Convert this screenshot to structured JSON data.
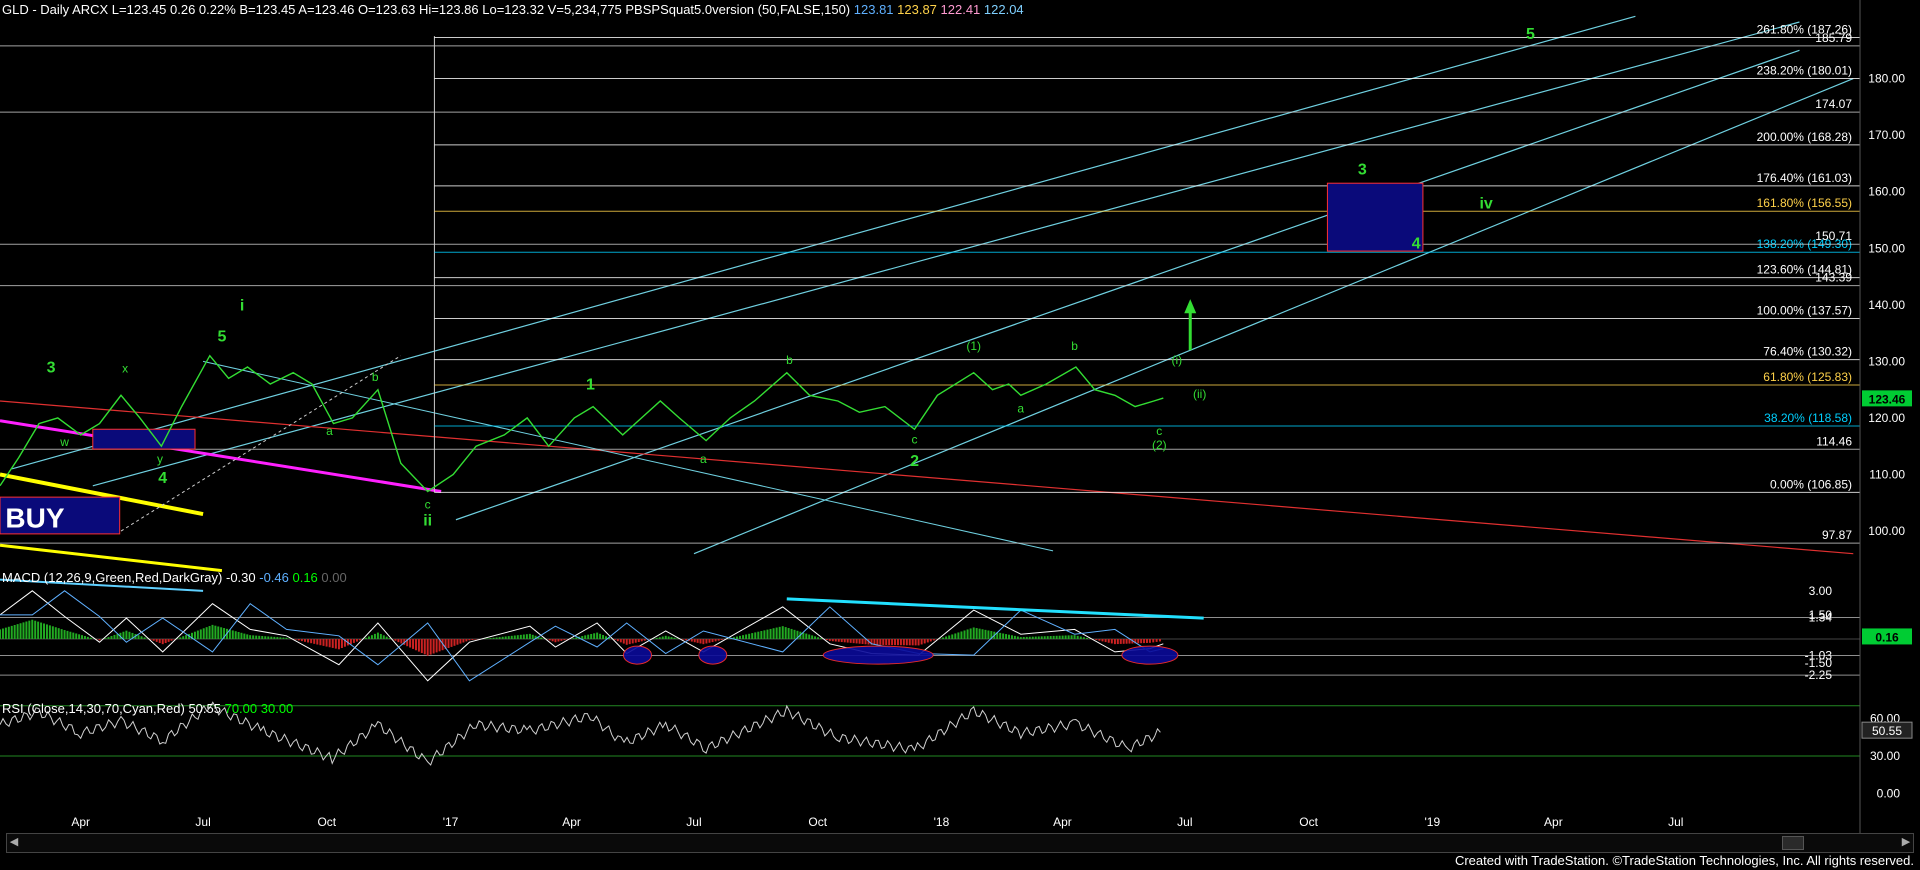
{
  "window": {
    "header_price": "GLD - Daily  ARCX  L=123.45  0.26  0.22%  B=123.45  A=123.46  O=123.63  Hi=123.86  Lo=123.32  V=5,234,775  PBSPSquat5.0version (50,FALSE,150)",
    "header_vals": [
      "123.81",
      "123.87",
      "122.41",
      "122.04"
    ],
    "header_colors": [
      "#5fb0ff",
      "#ffd24a",
      "#ff9ad0",
      "#7fd0ff"
    ],
    "macd_title": "MACD (12,26,9,Green,Red,DarkGray)",
    "macd_vals": [
      "-0.30",
      "-0.46",
      "0.16",
      "0.00"
    ],
    "macd_colors": [
      "#ffffff",
      "#5fb0ff",
      "#00ff00",
      "#666666"
    ],
    "rsi_title": "RSI (Close,14,30,70,Cyan,Red)",
    "rsi_vals": [
      "50.55",
      "70.00",
      "30.00"
    ],
    "rsi_colors": [
      "#ffffff",
      "#00ff00",
      "#00ff00"
    ],
    "footer": "Created with TradeStation. ©TradeStation Technologies, Inc. All rights reserved."
  },
  "chart_data": {
    "type": "line",
    "title": "GLD - Daily ARCX",
    "x_range": [
      "2016-02-01",
      "2019-11-15"
    ],
    "x_ticks": [
      {
        "date": "2016-04-01",
        "label": "Apr"
      },
      {
        "date": "2016-07-01",
        "label": "Jul"
      },
      {
        "date": "2016-10-01",
        "label": "Oct"
      },
      {
        "date": "2017-01-01",
        "label": "'17"
      },
      {
        "date": "2017-04-01",
        "label": "Apr"
      },
      {
        "date": "2017-07-01",
        "label": "Jul"
      },
      {
        "date": "2017-10-01",
        "label": "Oct"
      },
      {
        "date": "2018-01-01",
        "label": "'18"
      },
      {
        "date": "2018-04-01",
        "label": "Apr"
      },
      {
        "date": "2018-07-01",
        "label": "Jul"
      },
      {
        "date": "2018-10-01",
        "label": "Oct"
      },
      {
        "date": "2019-01-01",
        "label": "'19"
      },
      {
        "date": "2019-04-01",
        "label": "Apr"
      },
      {
        "date": "2019-07-01",
        "label": "Jul"
      }
    ],
    "price_axis": {
      "ylim": [
        94,
        190
      ],
      "ticks": [
        100,
        110,
        120,
        130,
        140,
        150,
        160,
        170,
        180
      ]
    },
    "last_price": "123.46",
    "price_series": [
      [
        "2016-02-01",
        108
      ],
      [
        "2016-02-15",
        113
      ],
      [
        "2016-03-01",
        119
      ],
      [
        "2016-03-15",
        120
      ],
      [
        "2016-04-01",
        117
      ],
      [
        "2016-04-15",
        119
      ],
      [
        "2016-05-01",
        124
      ],
      [
        "2016-05-15",
        120
      ],
      [
        "2016-05-31",
        115
      ],
      [
        "2016-06-15",
        122
      ],
      [
        "2016-07-06",
        131
      ],
      [
        "2016-07-20",
        127
      ],
      [
        "2016-08-03",
        129
      ],
      [
        "2016-08-20",
        126
      ],
      [
        "2016-09-06",
        128
      ],
      [
        "2016-09-20",
        126
      ],
      [
        "2016-10-06",
        119
      ],
      [
        "2016-10-20",
        120
      ],
      [
        "2016-11-08",
        125
      ],
      [
        "2016-11-25",
        112
      ],
      [
        "2016-12-15",
        107
      ],
      [
        "2017-01-03",
        110
      ],
      [
        "2017-01-20",
        115
      ],
      [
        "2017-02-10",
        117
      ],
      [
        "2017-02-27",
        120
      ],
      [
        "2017-03-15",
        115
      ],
      [
        "2017-04-03",
        120
      ],
      [
        "2017-04-17",
        122
      ],
      [
        "2017-05-09",
        117
      ],
      [
        "2017-06-06",
        123
      ],
      [
        "2017-06-20",
        120
      ],
      [
        "2017-07-10",
        116
      ],
      [
        "2017-07-28",
        120
      ],
      [
        "2017-08-15",
        123
      ],
      [
        "2017-09-08",
        128
      ],
      [
        "2017-09-25",
        124
      ],
      [
        "2017-10-16",
        123
      ],
      [
        "2017-11-01",
        121
      ],
      [
        "2017-11-20",
        122
      ],
      [
        "2017-12-12",
        118
      ],
      [
        "2017-12-29",
        124
      ],
      [
        "2018-01-25",
        128
      ],
      [
        "2018-02-08",
        125
      ],
      [
        "2018-02-20",
        126
      ],
      [
        "2018-03-01",
        124
      ],
      [
        "2018-03-20",
        126
      ],
      [
        "2018-04-11",
        129
      ],
      [
        "2018-04-25",
        125
      ],
      [
        "2018-05-10",
        124
      ],
      [
        "2018-05-25",
        122
      ],
      [
        "2018-06-08",
        123
      ],
      [
        "2018-06-15",
        123.5
      ]
    ],
    "fib_levels": [
      {
        "y": 106.85,
        "label": "0.00% (106.85)",
        "color": "#ffffff"
      },
      {
        "y": 118.58,
        "label": "38.20% (118.58)",
        "color": "#00d0ff"
      },
      {
        "y": 125.83,
        "label": "61.80% (125.83)",
        "color": "#ffd24a"
      },
      {
        "y": 130.32,
        "label": "76.40% (130.32)",
        "color": "#ffffff"
      },
      {
        "y": 137.57,
        "label": "100.00% (137.57)",
        "color": "#ffffff"
      },
      {
        "y": 144.81,
        "label": "123.60% (144.81)",
        "color": "#ffffff"
      },
      {
        "y": 149.3,
        "label": "138.20% (149.30)",
        "color": "#00d0ff"
      },
      {
        "y": 156.55,
        "label": "161.80% (156.55)",
        "color": "#ffd24a"
      },
      {
        "y": 161.03,
        "label": "176.40% (161.03)",
        "color": "#ffffff"
      },
      {
        "y": 168.28,
        "label": "200.00% (168.28)",
        "color": "#ffffff"
      },
      {
        "y": 180.01,
        "label": "238.20% (180.01)",
        "color": "#ffffff"
      },
      {
        "y": 187.26,
        "label": "261.80% (187.26)",
        "color": "#ffffff"
      }
    ],
    "hlines": [
      {
        "y": 97.87,
        "label": "97.87"
      },
      {
        "y": 114.46,
        "label": "114.46"
      },
      {
        "y": 143.39,
        "label": "143.39"
      },
      {
        "y": 150.71,
        "label": "150.71"
      },
      {
        "y": 174.07,
        "label": "174.07"
      },
      {
        "y": 185.79,
        "label": "185.79"
      }
    ],
    "wave_labels": [
      {
        "t": "3",
        "d": "2016-03-10",
        "y": 128
      },
      {
        "t": "w",
        "d": "2016-03-20",
        "y": 115
      },
      {
        "t": "x",
        "d": "2016-05-04",
        "y": 128
      },
      {
        "t": "y",
        "d": "2016-05-30",
        "y": 112
      },
      {
        "t": "4",
        "d": "2016-06-01",
        "y": 108.5
      },
      {
        "t": "5",
        "d": "2016-07-15",
        "y": 133.5
      },
      {
        "t": "i",
        "d": "2016-07-30",
        "y": 139
      },
      {
        "t": "a",
        "d": "2016-10-03",
        "y": 117
      },
      {
        "t": "b",
        "d": "2016-11-06",
        "y": 126.5
      },
      {
        "t": "c",
        "d": "2016-12-15",
        "y": 104
      },
      {
        "t": "ii",
        "d": "2016-12-15",
        "y": 101
      },
      {
        "t": "1",
        "d": "2017-04-15",
        "y": 125
      },
      {
        "t": "a",
        "d": "2017-07-08",
        "y": 112
      },
      {
        "t": "b",
        "d": "2017-09-10",
        "y": 129.5
      },
      {
        "t": "c",
        "d": "2017-12-12",
        "y": 115.5
      },
      {
        "t": "2",
        "d": "2017-12-12",
        "y": 111.5
      },
      {
        "t": "(1)",
        "d": "2018-01-25",
        "y": 132
      },
      {
        "t": "a",
        "d": "2018-03-01",
        "y": 121
      },
      {
        "t": "b",
        "d": "2018-04-10",
        "y": 132
      },
      {
        "t": "c",
        "d": "2018-06-12",
        "y": 117
      },
      {
        "t": "(2)",
        "d": "2018-06-12",
        "y": 114.5
      },
      {
        "t": "(i)",
        "d": "2018-06-25",
        "y": 129.5
      },
      {
        "t": "(ii)",
        "d": "2018-07-12",
        "y": 123.5
      },
      {
        "t": "3",
        "d": "2018-11-10",
        "y": 163
      },
      {
        "t": "4",
        "d": "2018-12-20",
        "y": 150
      },
      {
        "t": "iv",
        "d": "2019-02-10",
        "y": 157
      },
      {
        "t": "5",
        "d": "2019-03-15",
        "y": 187
      }
    ],
    "boxes": [
      {
        "x1": "2018-10-15",
        "x2": "2018-12-25",
        "y1": 149.5,
        "y2": 161.5,
        "fill": "#0a0a7a",
        "stroke": "#ff3030"
      },
      {
        "x1": "2016-04-10",
        "x2": "2016-06-25",
        "y1": 114.5,
        "y2": 118,
        "fill": "#0a0a7a",
        "stroke": "#ff3030"
      },
      {
        "x1": "2016-02-01",
        "x2": "2016-04-30",
        "y1": 99.5,
        "y2": 106,
        "fill": "#0a0a7a",
        "stroke": "#ff3030"
      }
    ],
    "buy_label": "BUY",
    "macd": {
      "ylim": [
        -3.3,
        3.8
      ],
      "ticks": [
        -2.25,
        -1.03,
        1.34
      ],
      "tick_labels": [
        "3.00",
        "1.50",
        "1.34",
        "-1.03",
        "-1.50",
        "-2.25"
      ],
      "tick_vals": [
        3.0,
        1.5,
        1.34,
        -1.03,
        -1.5,
        -2.25
      ],
      "hline_vals": [
        1.34,
        -1.03,
        -2.25
      ],
      "last": "0.16",
      "series": [
        [
          "2016-02-01",
          1.5
        ],
        [
          "2016-02-25",
          3.0
        ],
        [
          "2016-03-20",
          1.4
        ],
        [
          "2016-04-15",
          -0.2
        ],
        [
          "2016-05-05",
          1.3
        ],
        [
          "2016-06-01",
          -0.8
        ],
        [
          "2016-07-08",
          2.2
        ],
        [
          "2016-08-05",
          0.6
        ],
        [
          "2016-09-01",
          0.2
        ],
        [
          "2016-10-10",
          -1.6
        ],
        [
          "2016-11-08",
          1.0
        ],
        [
          "2016-12-15",
          -2.6
        ],
        [
          "2017-01-15",
          -0.2
        ],
        [
          "2017-03-01",
          0.8
        ],
        [
          "2017-03-20",
          -0.5
        ],
        [
          "2017-04-20",
          1.0
        ],
        [
          "2017-05-12",
          -0.9
        ],
        [
          "2017-06-10",
          0.5
        ],
        [
          "2017-07-08",
          -0.8
        ],
        [
          "2017-09-05",
          2.0
        ],
        [
          "2017-10-10",
          -0.3
        ],
        [
          "2017-11-10",
          -0.9
        ],
        [
          "2017-12-15",
          -1.0
        ],
        [
          "2018-01-25",
          1.8
        ],
        [
          "2018-03-01",
          0.3
        ],
        [
          "2018-04-10",
          0.6
        ],
        [
          "2018-05-10",
          -0.8
        ],
        [
          "2018-06-05",
          -0.6
        ],
        [
          "2018-06-15",
          -0.3
        ]
      ]
    },
    "rsi": {
      "ylim": [
        -5,
        65
      ],
      "tick_vals": [
        60,
        50.55,
        30,
        0
      ],
      "tick_labels": [
        "60.00",
        "50.55",
        "30.00",
        "0.00"
      ],
      "last": "50.55",
      "series": [
        [
          "2016-02-01",
          55
        ],
        [
          "2016-03-01",
          65
        ],
        [
          "2016-04-01",
          48
        ],
        [
          "2016-05-01",
          58
        ],
        [
          "2016-06-01",
          42
        ],
        [
          "2016-07-06",
          70
        ],
        [
          "2016-08-15",
          50
        ],
        [
          "2016-10-05",
          28
        ],
        [
          "2016-11-08",
          55
        ],
        [
          "2016-12-15",
          25
        ],
        [
          "2017-01-20",
          55
        ],
        [
          "2017-03-01",
          50
        ],
        [
          "2017-04-15",
          62
        ],
        [
          "2017-05-10",
          40
        ],
        [
          "2017-06-10",
          55
        ],
        [
          "2017-07-10",
          36
        ],
        [
          "2017-09-08",
          66
        ],
        [
          "2017-10-15",
          45
        ],
        [
          "2017-12-12",
          35
        ],
        [
          "2018-01-25",
          66
        ],
        [
          "2018-03-01",
          48
        ],
        [
          "2018-04-11",
          56
        ],
        [
          "2018-05-20",
          36
        ],
        [
          "2018-06-15",
          50
        ]
      ]
    }
  }
}
